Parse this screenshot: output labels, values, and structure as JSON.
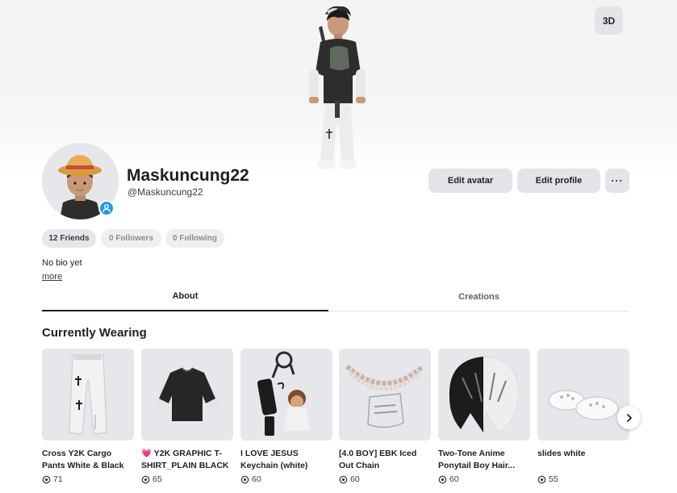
{
  "hero": {
    "view_toggle_label": "3D"
  },
  "profile": {
    "display_name": "Maskuncung22",
    "username": "@Maskuncung22",
    "edit_avatar_label": "Edit avatar",
    "edit_profile_label": "Edit profile",
    "more_label": "···",
    "stats": {
      "friends": "12 Friends",
      "followers": "0 Followers",
      "following": "0 Following"
    },
    "bio": "No bio yet",
    "bio_more_label": "more"
  },
  "tabs": [
    {
      "label": "About",
      "active": true
    },
    {
      "label": "Creations",
      "active": false
    }
  ],
  "currently_wearing": {
    "title": "Currently Wearing",
    "items": [
      {
        "name": "Cross Y2K Cargo Pants White & Black",
        "price": "71",
        "icon": "cargo-pants"
      },
      {
        "name": "💗 Y2K GRAPHIC T-SHIRT_PLAIN BLACK",
        "price": "65",
        "icon": "t-shirt"
      },
      {
        "name": "I LOVE JESUS Keychain (white)",
        "price": "60",
        "icon": "keychain"
      },
      {
        "name": "[4.0 BOY] EBK Iced Out Chain",
        "price": "60",
        "icon": "chain"
      },
      {
        "name": "Two-Tone Anime Ponytail Boy Hair...",
        "price": "60",
        "icon": "hair"
      },
      {
        "name": "slides white",
        "price": "55",
        "icon": "slides"
      }
    ]
  },
  "colors": {
    "accent_blue": "#1e9be6",
    "button_bg": "#e3e4e8",
    "text_primary": "#1f1f22"
  }
}
